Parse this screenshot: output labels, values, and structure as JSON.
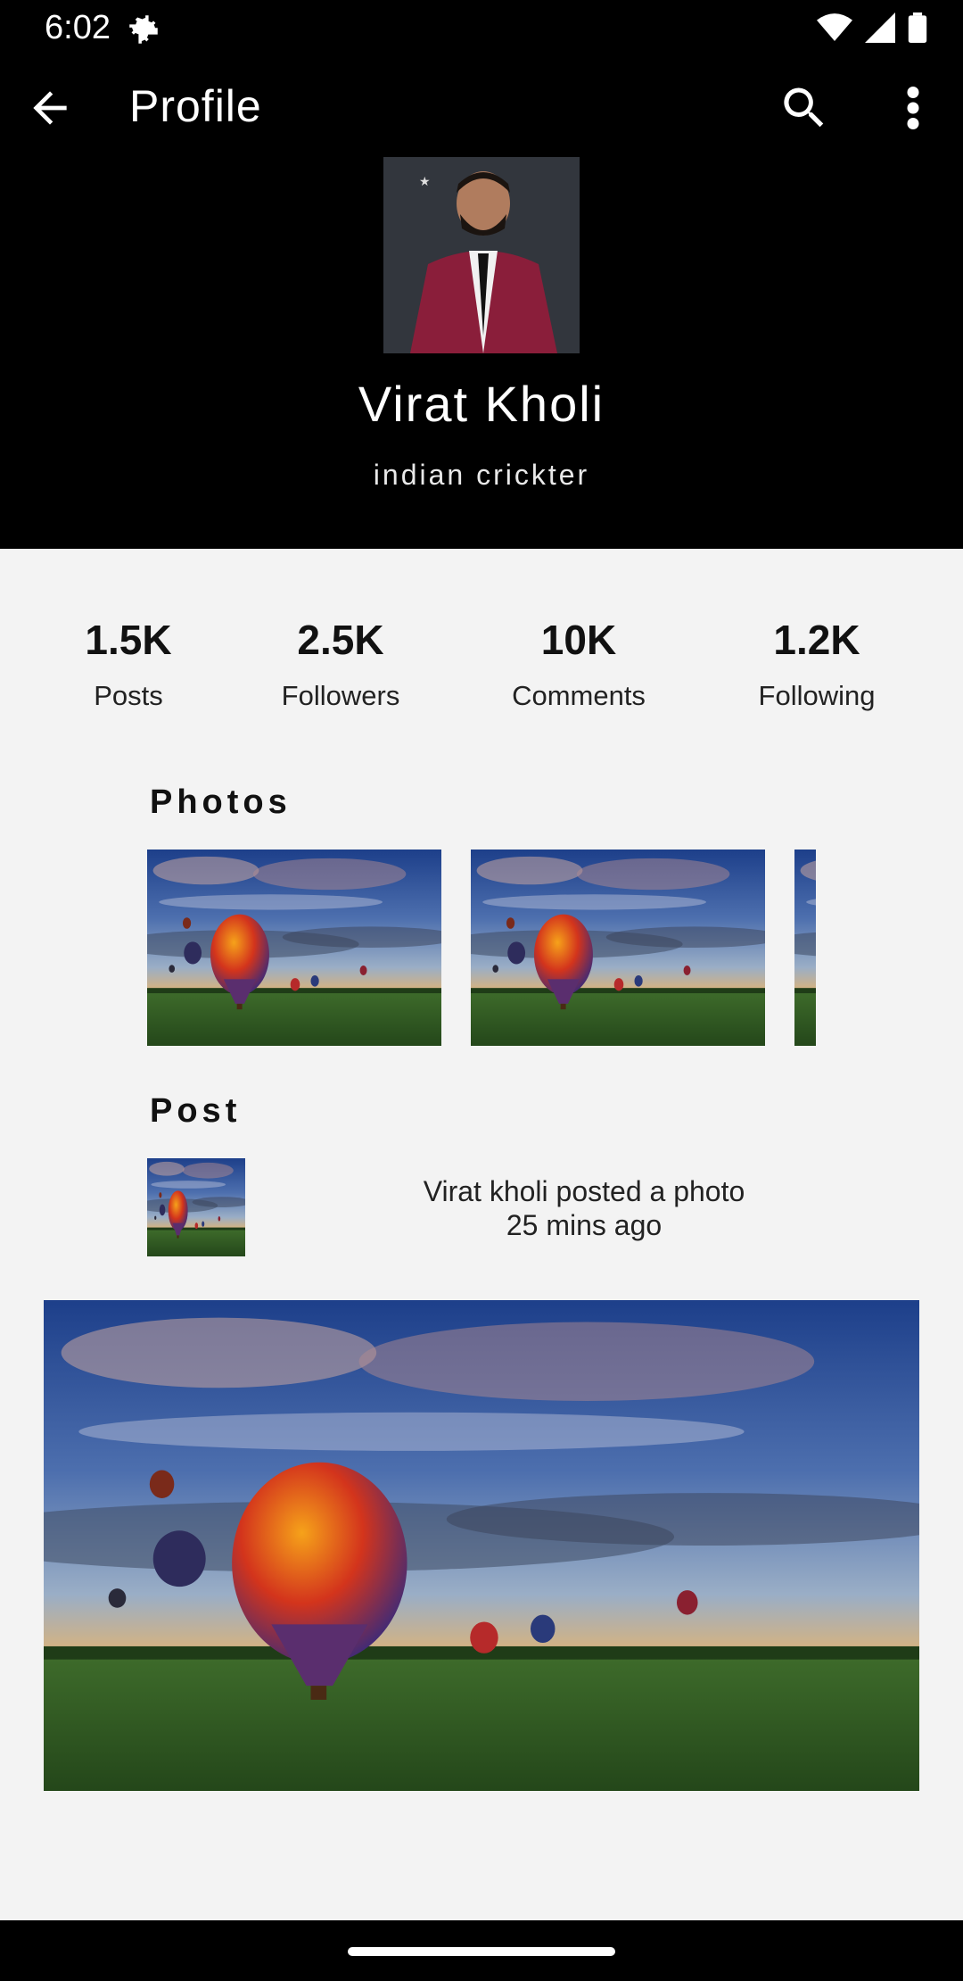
{
  "status_bar": {
    "time": "6:02"
  },
  "app_bar": {
    "title": "Profile"
  },
  "profile": {
    "name": "Virat Kholi",
    "bio": "indian crickter"
  },
  "stats": [
    {
      "value": "1.5K",
      "label": "Posts"
    },
    {
      "value": "2.5K",
      "label": "Followers"
    },
    {
      "value": "10K",
      "label": "Comments"
    },
    {
      "value": "1.2K",
      "label": "Following"
    }
  ],
  "sections": {
    "photos_title": "Photos",
    "post_title": "Post"
  },
  "post": {
    "line1": "Virat kholi posted a photo",
    "line2": "25 mins ago"
  },
  "icons": {
    "back": "arrow-back-icon",
    "search": "search-icon",
    "more": "more-vert-icon",
    "wifi": "wifi-icon",
    "signal": "signal-icon",
    "battery": "battery-icon",
    "settings": "gear-icon"
  },
  "colors": {
    "header_bg": "#000000",
    "page_bg": "#f3f3f3"
  }
}
